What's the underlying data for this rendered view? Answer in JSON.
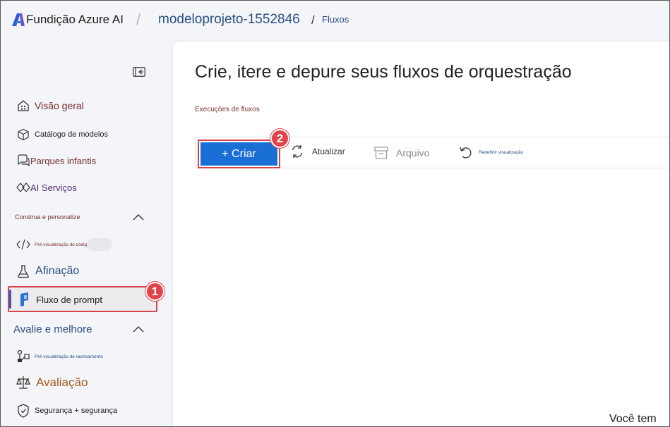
{
  "header": {
    "brand": "Fundição Azure AI",
    "separator": "/",
    "project": "modeloprojeto-1552846",
    "crumb_separator": "/",
    "crumb_current": "Fluxos"
  },
  "sidebar": {
    "items": [
      {
        "label": "Visão geral",
        "icon": "home-grid-icon"
      },
      {
        "label": "Catálogo de modelos",
        "icon": "cube-icon"
      },
      {
        "label": "Parques infantis",
        "icon": "chat-bubbles-icon"
      },
      {
        "label": "AI Serviços",
        "icon": "services-diamond-icon"
      }
    ],
    "section_build": "Construa e personalize",
    "build_items": [
      {
        "label": "Pré-visualização do código",
        "icon": "code-icon"
      },
      {
        "label": "Afinação",
        "icon": "flask-icon"
      },
      {
        "label": "Fluxo de prompt",
        "icon": "prompt-flow-icon",
        "selected": true
      }
    ],
    "section_evaluate": "Avalie e melhore",
    "evaluate_items": [
      {
        "label": "Pré-visualização de rastreamento",
        "icon": "tracing-icon"
      },
      {
        "label": "Avaliação",
        "icon": "scale-icon"
      },
      {
        "label": "Segurança + segurança",
        "icon": "shield-icon"
      }
    ]
  },
  "main": {
    "title": "Crie, itere e depure seus fluxos de orquestração",
    "tab": "Execuções de fluxos",
    "toolbar": {
      "create": "+ Criar",
      "refresh": "Atualizar",
      "archive": "Arquivo",
      "reset_view": "Redefinir visualização"
    }
  },
  "callouts": {
    "one": "1",
    "two": "2"
  },
  "footer_text": "Você tem",
  "colors": {
    "accent_blue": "#1a6fd6",
    "highlight_red": "#d8434a",
    "nav_text": "#7a2e2e",
    "project_blue": "#2b4f83"
  }
}
